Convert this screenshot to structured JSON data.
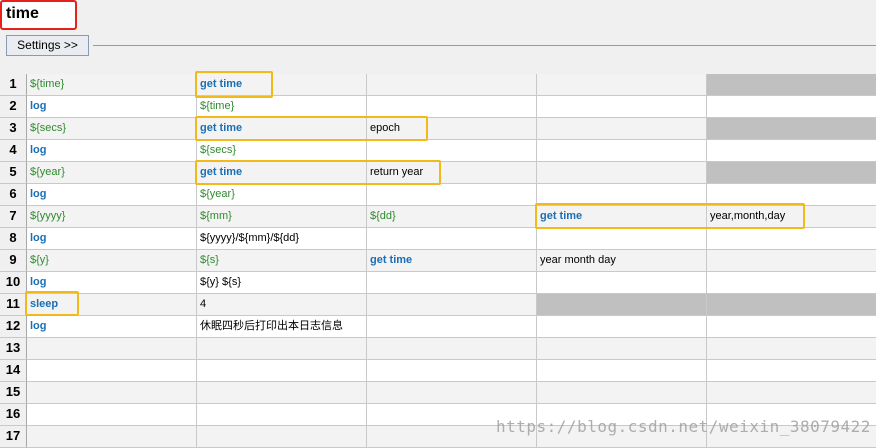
{
  "header": {
    "title": "time",
    "settings_label": "Settings >>"
  },
  "rows": [
    {
      "num": "1",
      "cells": [
        {
          "t": "${time}",
          "k": "var"
        },
        {
          "t": "get time",
          "k": "kw"
        },
        {
          "t": "",
          "k": "txt"
        },
        {
          "t": "",
          "k": "txt"
        },
        {
          "t": "",
          "k": "gray"
        }
      ]
    },
    {
      "num": "2",
      "cells": [
        {
          "t": "log",
          "k": "kw"
        },
        {
          "t": "${time}",
          "k": "var"
        },
        {
          "t": "",
          "k": "txt"
        },
        {
          "t": "",
          "k": "txt"
        },
        {
          "t": "",
          "k": "txt"
        }
      ]
    },
    {
      "num": "3",
      "cells": [
        {
          "t": "${secs}",
          "k": "var"
        },
        {
          "t": "get time",
          "k": "kw"
        },
        {
          "t": "epoch",
          "k": "txt"
        },
        {
          "t": "",
          "k": "txt"
        },
        {
          "t": "",
          "k": "gray"
        }
      ]
    },
    {
      "num": "4",
      "cells": [
        {
          "t": "log",
          "k": "kw"
        },
        {
          "t": "${secs}",
          "k": "var"
        },
        {
          "t": "",
          "k": "txt"
        },
        {
          "t": "",
          "k": "txt"
        },
        {
          "t": "",
          "k": "txt"
        }
      ]
    },
    {
      "num": "5",
      "cells": [
        {
          "t": "${year}",
          "k": "var"
        },
        {
          "t": "get time",
          "k": "kw"
        },
        {
          "t": "return year",
          "k": "txt"
        },
        {
          "t": "",
          "k": "txt"
        },
        {
          "t": "",
          "k": "gray"
        }
      ]
    },
    {
      "num": "6",
      "cells": [
        {
          "t": "log",
          "k": "kw"
        },
        {
          "t": "${year}",
          "k": "var"
        },
        {
          "t": "",
          "k": "txt"
        },
        {
          "t": "",
          "k": "txt"
        },
        {
          "t": "",
          "k": "txt"
        }
      ]
    },
    {
      "num": "7",
      "cells": [
        {
          "t": "${yyyy}",
          "k": "var"
        },
        {
          "t": "${mm}",
          "k": "var"
        },
        {
          "t": "${dd}",
          "k": "var"
        },
        {
          "t": "get time",
          "k": "kw"
        },
        {
          "t": "year,month,day",
          "k": "txt"
        }
      ]
    },
    {
      "num": "8",
      "cells": [
        {
          "t": "log",
          "k": "kw"
        },
        {
          "t": "${yyyy}/${mm}/${dd}",
          "k": "txt"
        },
        {
          "t": "",
          "k": "txt"
        },
        {
          "t": "",
          "k": "txt"
        },
        {
          "t": "",
          "k": "txt"
        }
      ]
    },
    {
      "num": "9",
      "cells": [
        {
          "t": "${y}",
          "k": "var"
        },
        {
          "t": "${s}",
          "k": "var"
        },
        {
          "t": "get time",
          "k": "kw"
        },
        {
          "t": "year month day",
          "k": "txt"
        },
        {
          "t": "",
          "k": "txt"
        }
      ]
    },
    {
      "num": "10",
      "cells": [
        {
          "t": "log",
          "k": "kw"
        },
        {
          "t": "${y} ${s}",
          "k": "txt"
        },
        {
          "t": "",
          "k": "txt"
        },
        {
          "t": "",
          "k": "txt"
        },
        {
          "t": "",
          "k": "txt"
        }
      ]
    },
    {
      "num": "11",
      "cells": [
        {
          "t": "sleep",
          "k": "kw"
        },
        {
          "t": "4",
          "k": "txt"
        },
        {
          "t": "",
          "k": "txt"
        },
        {
          "t": "",
          "k": "gray"
        },
        {
          "t": "",
          "k": "gray"
        }
      ]
    },
    {
      "num": "12",
      "cells": [
        {
          "t": "log",
          "k": "kw"
        },
        {
          "t": "休眠四秒后打印出本日志信息",
          "k": "txt"
        },
        {
          "t": "",
          "k": "txt"
        },
        {
          "t": "",
          "k": "txt"
        },
        {
          "t": "",
          "k": "txt"
        }
      ]
    },
    {
      "num": "13",
      "cells": [
        {
          "t": "",
          "k": "txt"
        },
        {
          "t": "",
          "k": "txt"
        },
        {
          "t": "",
          "k": "txt"
        },
        {
          "t": "",
          "k": "txt"
        },
        {
          "t": "",
          "k": "txt"
        }
      ]
    },
    {
      "num": "14",
      "cells": [
        {
          "t": "",
          "k": "txt"
        },
        {
          "t": "",
          "k": "txt"
        },
        {
          "t": "",
          "k": "txt"
        },
        {
          "t": "",
          "k": "txt"
        },
        {
          "t": "",
          "k": "txt"
        }
      ]
    },
    {
      "num": "15",
      "cells": [
        {
          "t": "",
          "k": "txt"
        },
        {
          "t": "",
          "k": "txt"
        },
        {
          "t": "",
          "k": "txt"
        },
        {
          "t": "",
          "k": "txt"
        },
        {
          "t": "",
          "k": "txt"
        }
      ]
    },
    {
      "num": "16",
      "cells": [
        {
          "t": "",
          "k": "txt"
        },
        {
          "t": "",
          "k": "txt"
        },
        {
          "t": "",
          "k": "txt"
        },
        {
          "t": "",
          "k": "txt"
        },
        {
          "t": "",
          "k": "txt"
        }
      ]
    },
    {
      "num": "17",
      "cells": [
        {
          "t": "",
          "k": "txt"
        },
        {
          "t": "",
          "k": "txt"
        },
        {
          "t": "",
          "k": "txt"
        },
        {
          "t": "",
          "k": "txt"
        },
        {
          "t": "",
          "k": "txt"
        }
      ]
    }
  ],
  "watermark": "https://blog.csdn.net/weixin_38079422"
}
